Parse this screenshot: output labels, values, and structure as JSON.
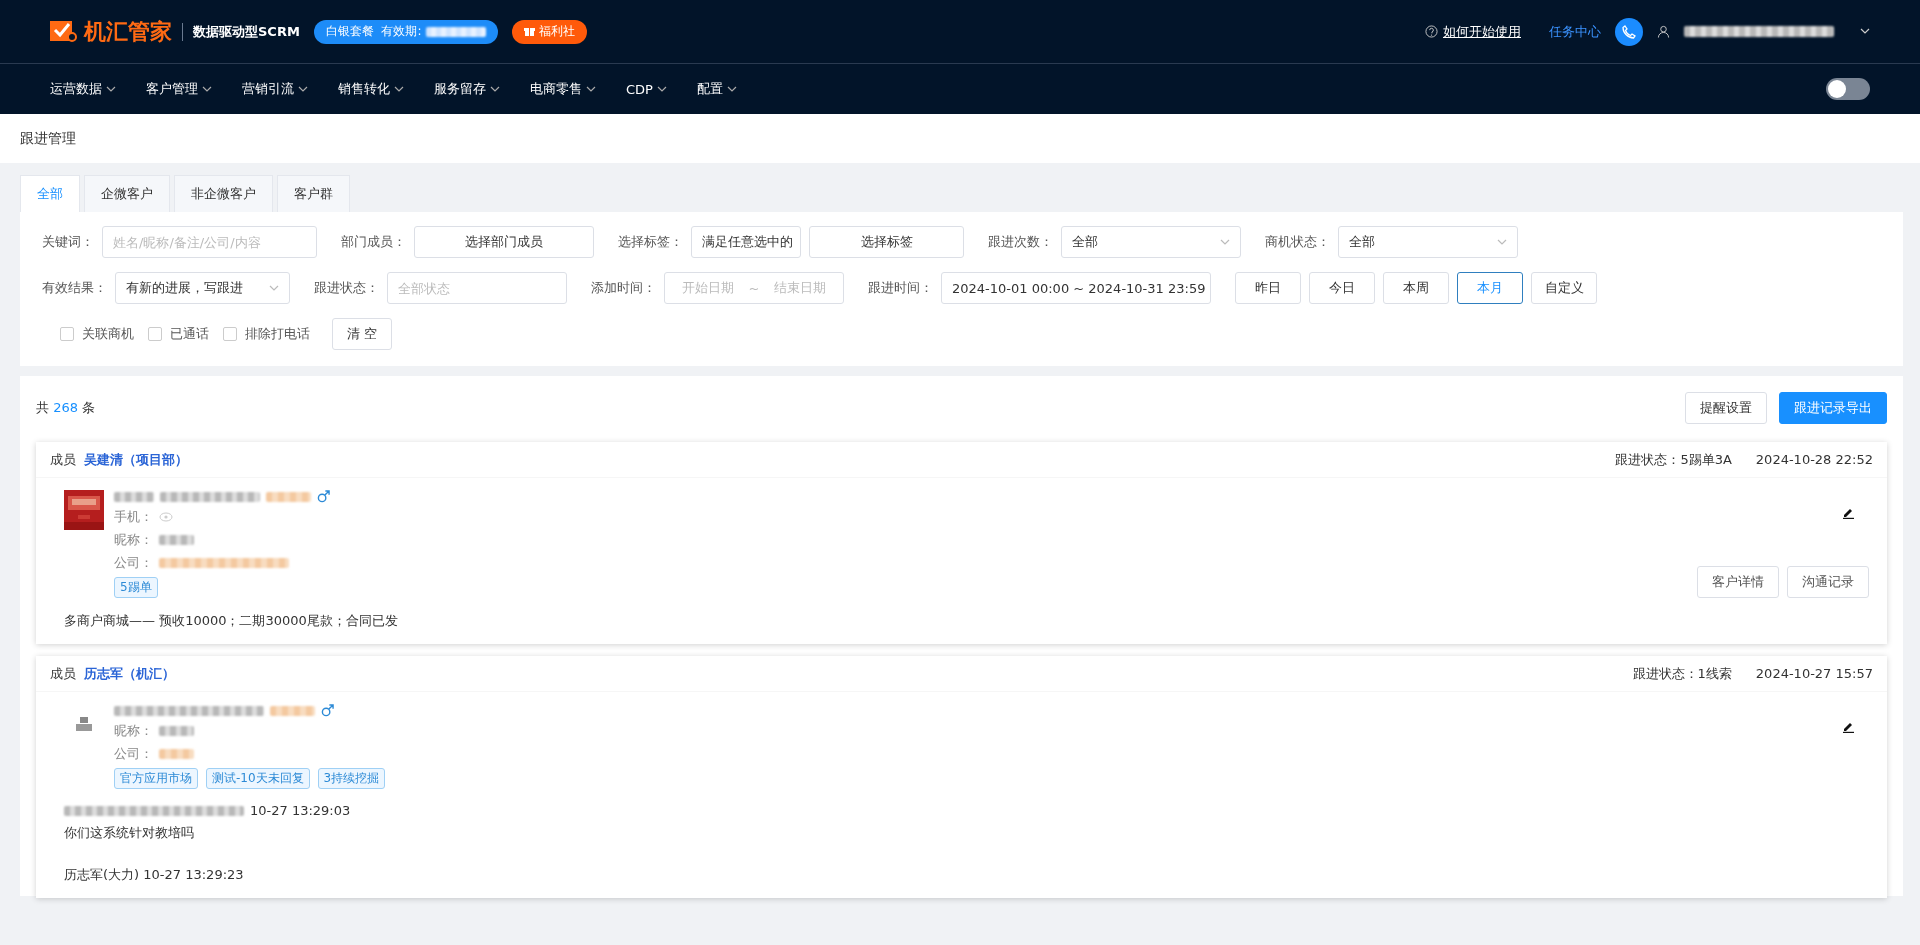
{
  "header": {
    "logo_text": "机汇管家",
    "slogan": "数据驱动型SCRM",
    "plan_badge": "白银套餐  有效期:",
    "welfare_badge": "福利社",
    "help_link": "如何开始使用",
    "task_center": "任务中心"
  },
  "nav": {
    "items": [
      "运营数据",
      "客户管理",
      "营销引流",
      "销售转化",
      "服务留存",
      "电商零售",
      "CDP",
      "配置"
    ],
    "theme_toggle": {
      "on": false
    }
  },
  "breadcrumb": "跟进管理",
  "tabs": [
    {
      "label": "全部",
      "selected": true
    },
    {
      "label": "企微客户",
      "selected": false
    },
    {
      "label": "非企微客户",
      "selected": false
    },
    {
      "label": "客户群",
      "selected": false
    }
  ],
  "filter_rows": [
    [
      {
        "label": "关键词：",
        "controls": [
          {
            "kind": "input",
            "placeholder": "姓名/昵称/备注/公司/内容"
          }
        ]
      },
      {
        "label": "部门成员：",
        "controls": [
          {
            "kind": "picker",
            "text": "选择部门成员"
          }
        ]
      },
      {
        "label": "选择标签：",
        "controls": [
          {
            "kind": "mini-select",
            "value": "满足任意选中的"
          },
          {
            "kind": "tag-picker",
            "text": "选择标签"
          }
        ]
      },
      {
        "label": "跟进次数：",
        "controls": [
          {
            "kind": "select",
            "value": "全部"
          }
        ]
      },
      {
        "label": "商机状态：",
        "controls": [
          {
            "kind": "select",
            "value": "全部"
          }
        ]
      }
    ],
    [
      {
        "label": "有效结果：",
        "controls": [
          {
            "kind": "wide-select",
            "value": "有新的进展，写跟进"
          }
        ]
      },
      {
        "label": "跟进状态：",
        "controls": [
          {
            "kind": "input-short",
            "placeholder": "全部状态"
          }
        ]
      },
      {
        "label": "添加时间：",
        "controls": [
          {
            "kind": "daterange",
            "start": "开始日期",
            "sep": "~",
            "end": "结束日期"
          }
        ]
      },
      {
        "label": "跟进时间：",
        "controls": [
          {
            "kind": "datetime",
            "value": "2024-10-01 00:00 ~ 2024-10-31 23:59"
          }
        ]
      }
    ]
  ],
  "quick_ranges": [
    {
      "label": "昨日",
      "selected": false
    },
    {
      "label": "今日",
      "selected": false
    },
    {
      "label": "本周",
      "selected": false
    },
    {
      "label": "本月",
      "selected": true
    },
    {
      "label": "自定义",
      "selected": false
    }
  ],
  "checkboxes": [
    {
      "label": "关联商机",
      "checked": false
    },
    {
      "label": "已通话",
      "checked": false
    },
    {
      "label": "排除打电话",
      "checked": false
    }
  ],
  "clear_button": "清 空",
  "list": {
    "total_prefix": "共",
    "total": "268",
    "total_suffix": "条",
    "buttons": [
      {
        "label": "提醒设置",
        "kind": "default"
      },
      {
        "label": "跟进记录导出",
        "kind": "primary"
      }
    ]
  },
  "records": [
    {
      "member_label": "成员",
      "member": "吴建清（项目部）",
      "status_label": "跟进状态：",
      "status": "5踢单3A",
      "time": "2024-10-28 22:52",
      "avatar": {
        "kind": "picture"
      },
      "gender": {
        "kind": "male"
      },
      "fields": [
        {
          "label": "手机：",
          "kind": "hidden-phone"
        },
        {
          "label": "昵称：",
          "kind": "blurred"
        },
        {
          "label": "公司：",
          "kind": "blurred-orange"
        }
      ],
      "tags": [
        "5踢单"
      ],
      "notes": [
        {
          "kind": "plain",
          "text": "多商户商城—— 预收10000；二期30000尾款；合同已发"
        }
      ],
      "actions": [
        "客户详情",
        "沟通记录"
      ]
    },
    {
      "member_label": "成员",
      "member": "历志军（机汇）",
      "status_label": "跟进状态：",
      "status": "1线索",
      "time": "2024-10-27 15:57",
      "avatar": {
        "kind": "placeholder"
      },
      "gender": {
        "kind": "male"
      },
      "fields": [
        {
          "label": "昵称：",
          "kind": "blurred"
        },
        {
          "label": "公司：",
          "kind": "blurred-orange"
        }
      ],
      "tags": [
        "官方应用市场",
        "测试-10天未回复",
        "3持续挖掘"
      ],
      "notes": [
        {
          "kind": "message",
          "sender_hidden": true,
          "time": "10-27 13:29:03",
          "text": "你们这系统针对教培吗"
        },
        {
          "kind": "message",
          "sender": "历志军(大力)",
          "time": "10-27 13:29:23"
        }
      ]
    }
  ]
}
